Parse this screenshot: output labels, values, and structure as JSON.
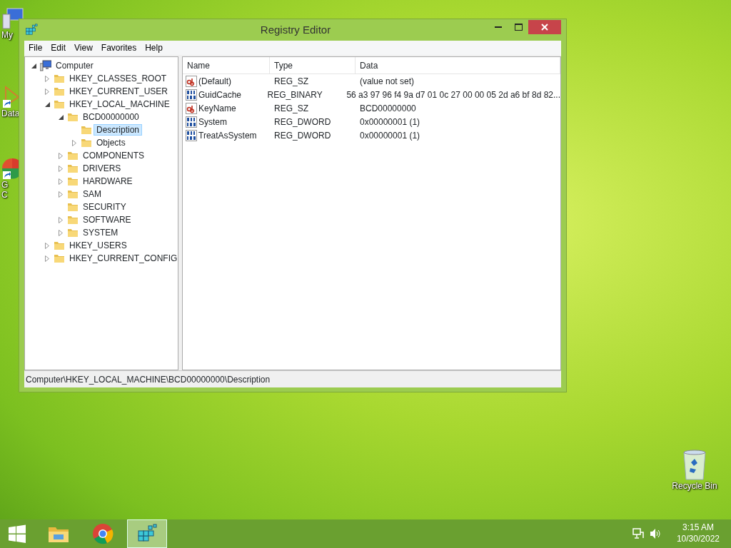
{
  "desktop_icons": [
    {
      "kind": "computer",
      "lines": [
        "My"
      ]
    },
    {
      "kind": "shortcut",
      "lines": [
        "Data"
      ]
    },
    {
      "kind": "browser",
      "lines": [
        "G",
        "C"
      ]
    },
    {
      "kind": "recycle",
      "lines": [
        "Recycle Bin"
      ]
    }
  ],
  "window": {
    "title": "Registry Editor"
  },
  "menu": [
    "File",
    "Edit",
    "View",
    "Favorites",
    "Help"
  ],
  "tree": [
    {
      "label": "Computer",
      "kind": "computer",
      "expanded": true,
      "has_subkeys": true,
      "selected": false,
      "children": [
        {
          "label": "HKEY_CLASSES_ROOT",
          "kind": "folder",
          "expanded": false,
          "has_subkeys": true,
          "selected": false
        },
        {
          "label": "HKEY_CURRENT_USER",
          "kind": "folder",
          "expanded": false,
          "has_subkeys": true,
          "selected": false
        },
        {
          "label": "HKEY_LOCAL_MACHINE",
          "kind": "folder",
          "expanded": true,
          "has_subkeys": true,
          "selected": false,
          "children": [
            {
              "label": "BCD00000000",
              "kind": "folder",
              "expanded": true,
              "has_subkeys": true,
              "selected": false,
              "children": [
                {
                  "label": "Description",
                  "kind": "folder",
                  "selected": true
                },
                {
                  "label": "Objects",
                  "kind": "folder",
                  "expanded": false,
                  "has_subkeys": true,
                  "selected": false
                }
              ]
            },
            {
              "label": "COMPONENTS",
              "kind": "folder",
              "expanded": false,
              "has_subkeys": true,
              "selected": false
            },
            {
              "label": "DRIVERS",
              "kind": "folder",
              "expanded": false,
              "has_subkeys": true,
              "selected": false
            },
            {
              "label": "HARDWARE",
              "kind": "folder",
              "expanded": false,
              "has_subkeys": true,
              "selected": false
            },
            {
              "label": "SAM",
              "kind": "folder",
              "expanded": false,
              "has_subkeys": true,
              "selected": false
            },
            {
              "label": "SECURITY",
              "kind": "folder",
              "selected": false
            },
            {
              "label": "SOFTWARE",
              "kind": "folder",
              "expanded": false,
              "has_subkeys": true,
              "selected": false
            },
            {
              "label": "SYSTEM",
              "kind": "folder",
              "expanded": false,
              "has_subkeys": true,
              "selected": false
            }
          ]
        },
        {
          "label": "HKEY_USERS",
          "kind": "folder",
          "expanded": false,
          "has_subkeys": true,
          "selected": false
        },
        {
          "label": "HKEY_CURRENT_CONFIG",
          "kind": "folder",
          "expanded": false,
          "has_subkeys": true,
          "selected": false
        }
      ]
    }
  ],
  "table": {
    "columns": [
      "Name",
      "Type",
      "Data"
    ],
    "rows": [
      {
        "kind": "string",
        "name": "(Default)",
        "type": "REG_SZ",
        "data": "(value not set)"
      },
      {
        "kind": "binary",
        "name": "GuidCache",
        "type": "REG_BINARY",
        "data": "56 a3 97 96 f4 9a d7 01 0c 27 00 00 05 2d a6 bf 8d 82..."
      },
      {
        "kind": "string",
        "name": "KeyName",
        "type": "REG_SZ",
        "data": "BCD00000000"
      },
      {
        "kind": "binary",
        "name": "System",
        "type": "REG_DWORD",
        "data": "0x00000001 (1)"
      },
      {
        "kind": "binary",
        "name": "TreatAsSystem",
        "type": "REG_DWORD",
        "data": "0x00000001 (1)"
      }
    ]
  },
  "status_bar": "Computer\\HKEY_LOCAL_MACHINE\\BCD00000000\\Description",
  "taskbar": {
    "buttons": [
      {
        "kind": "start",
        "selected": false
      },
      {
        "kind": "explorer",
        "selected": false
      },
      {
        "kind": "browser",
        "selected": false
      },
      {
        "kind": "regedit",
        "selected": true
      }
    ],
    "tray": {
      "time": "3:15 AM",
      "date": "10/30/2022"
    }
  }
}
